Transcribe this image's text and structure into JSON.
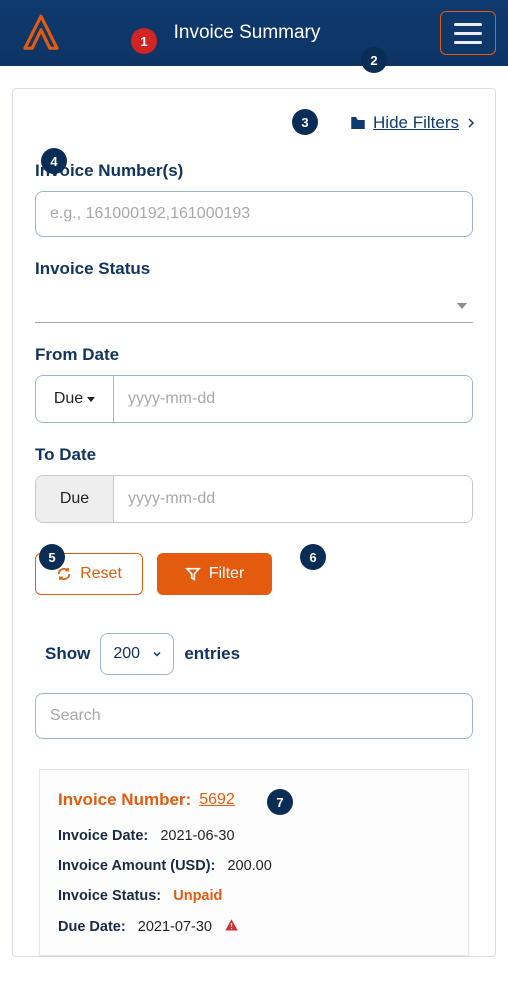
{
  "header": {
    "title": "Invoice Summary"
  },
  "filters": {
    "hide_label": " Hide Filters ",
    "invoice_numbers_label": "Invoice Number(s)",
    "invoice_numbers_placeholder": "e.g., 161000192,161000193",
    "status_label": "Invoice Status",
    "from_date_label": "From Date",
    "to_date_label": "To Date",
    "due_label": "Due",
    "date_placeholder": "yyyy-mm-dd",
    "reset_label": "Reset",
    "filter_label": "Filter"
  },
  "table_controls": {
    "show_label": "Show",
    "entries_label": "entries",
    "page_size": "200",
    "search_placeholder": "Search"
  },
  "invoice": {
    "number_label": "Invoice Number:",
    "number_value": "5692",
    "date_label": "Invoice Date:",
    "date_value": "2021-06-30",
    "amount_label": "Invoice Amount (USD):",
    "amount_value": "200.00",
    "status_label": "Invoice Status:",
    "status_value": "Unpaid",
    "due_label": "Due Date:",
    "due_value": "2021-07-30"
  },
  "badges": [
    "1",
    "2",
    "3",
    "4",
    "5",
    "6",
    "7"
  ]
}
